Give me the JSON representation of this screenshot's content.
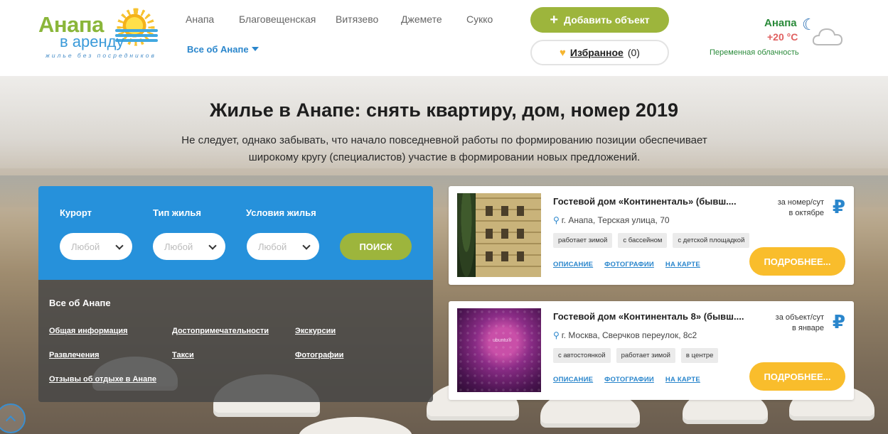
{
  "logo": {
    "title": "Анапа",
    "subtitle": "в аренду",
    "tagline": "жилье без посредников"
  },
  "nav": {
    "items": [
      "Анапа",
      "Благовещенская",
      "Витязево",
      "Джемете",
      "Сукко"
    ],
    "more_label": "Все об Анапе"
  },
  "header": {
    "add_button": "Добавить объект",
    "favorites_label": "Избранное",
    "favorites_count": "(0)"
  },
  "weather": {
    "city": "Анапа",
    "temp": "+20 °C",
    "description": "Переменная облачность"
  },
  "hero": {
    "title": "Жилье в Анапе: снять квартиру, дом, номер 2019",
    "subtitle": "Не следует, однако забывать, что начало повседневной работы по формированию позиции обеспечивает широкому кругу (специалистов) участие в формировании новых предложений."
  },
  "search": {
    "resort_label": "Курорт",
    "type_label": "Тип жилья",
    "conditions_label": "Условия жилья",
    "resort_value": "Любой",
    "type_value": "Любой",
    "conditions_value": "Любой",
    "search_button": "ПОИСК"
  },
  "info": {
    "title": "Все об Анапе",
    "links": [
      "Общая информация",
      "Достопримечательности",
      "Экскурсии",
      "Развлечения",
      "Такси",
      "Фотографии",
      "Отзывы об отдыхе в Анапе"
    ]
  },
  "listings": [
    {
      "title": "Гостевой дом «Континенталь» (бывш....",
      "address": "г. Анапа, Терская улица, 70",
      "tags": [
        "работает зимой",
        "с бассейном",
        "с детской площадкой"
      ],
      "links": [
        "ОПИСАНИЕ",
        "ФОТОГРАФИИ",
        "НА КАРТЕ"
      ],
      "price_line1": "за номер/сут",
      "price_line2": "в октябре",
      "currency": "₽",
      "more_button": "ПОДРОБНЕЕ..."
    },
    {
      "title": "Гостевой дом «Континенталь 8» (бывш....",
      "address": "г. Москва, Сверчков переулок, 8с2",
      "tags": [
        "с автостоянкой",
        "работает зимой",
        "в центре"
      ],
      "links": [
        "ОПИСАНИЕ",
        "ФОТОГРАФИИ",
        "НА КАРТЕ"
      ],
      "price_line1": "за объект/сут",
      "price_line2": "в январе",
      "currency": "₽",
      "more_button": "ПОДРОБНЕЕ...",
      "image_caption": "ubuntu®"
    }
  ],
  "colors": {
    "green": "#9db53c",
    "blue": "#2691db",
    "yellow": "#f9bd2c"
  }
}
